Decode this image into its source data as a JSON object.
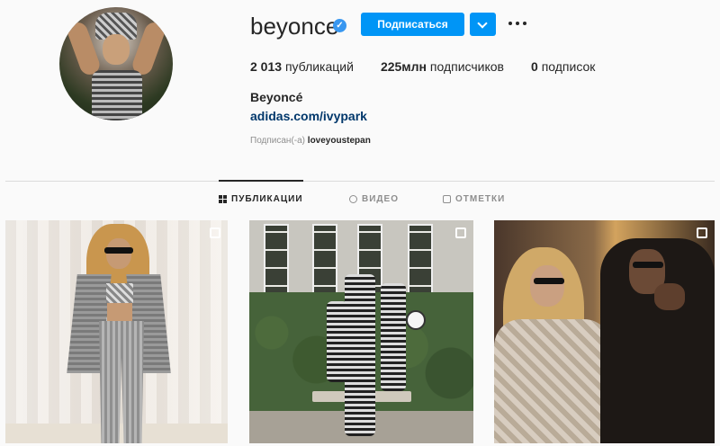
{
  "profile": {
    "username": "beyonce",
    "verified_mark": "✓",
    "follow_label": "Подписаться",
    "full_name": "Beyoncé",
    "bio_link": "adidas.com/ivypark",
    "followed_by_prefix": "Подписан(-а)",
    "followed_by_user": "loveyoustepan"
  },
  "stats": [
    {
      "value": "2 013",
      "label": "публикаций"
    },
    {
      "value": "225млн",
      "label": "подписчиков"
    },
    {
      "value": "0",
      "label": "подписок"
    }
  ],
  "tabs": [
    {
      "label": "ПУБЛИКАЦИИ",
      "icon": "grid-icon",
      "active": true
    },
    {
      "label": "ВИДЕО",
      "icon": "video-icon",
      "active": false
    },
    {
      "label": "ОТМЕТКИ",
      "icon": "tag-icon",
      "active": false
    }
  ],
  "posts": [
    {
      "icon": "multiple-photos-icon"
    },
    {
      "icon": "multiple-photos-icon"
    },
    {
      "icon": "multiple-photos-icon"
    }
  ],
  "colors": {
    "accent": "#0095f6",
    "verified": "#3897f0",
    "link": "#00376b",
    "text": "#262626",
    "muted": "#8e8e8e",
    "background": "#fafafa"
  }
}
